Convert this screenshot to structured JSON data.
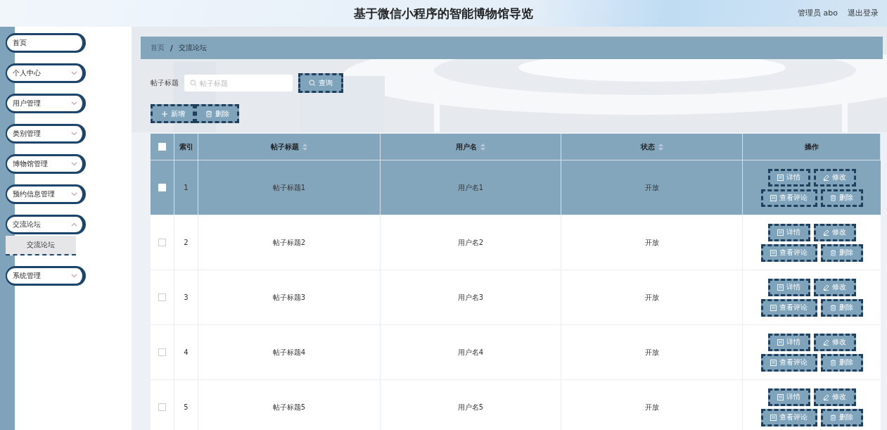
{
  "header": {
    "title": "基于微信小程序的智能博物馆导览",
    "user": "管理员 abo",
    "logout": "退出登录"
  },
  "sidebar": {
    "items": [
      {
        "label": "首页",
        "has_submenu": false
      },
      {
        "label": "个人中心",
        "has_submenu": true,
        "expanded": false
      },
      {
        "label": "用户管理",
        "has_submenu": true,
        "expanded": false
      },
      {
        "label": "类别管理",
        "has_submenu": true,
        "expanded": false
      },
      {
        "label": "博物馆管理",
        "has_submenu": true,
        "expanded": false
      },
      {
        "label": "预约信息管理",
        "has_submenu": true,
        "expanded": false
      },
      {
        "label": "交流论坛",
        "has_submenu": true,
        "expanded": true,
        "children": [
          {
            "label": "交流论坛",
            "selected": true
          }
        ]
      },
      {
        "label": "系统管理",
        "has_submenu": true,
        "expanded": false
      }
    ]
  },
  "breadcrumb": {
    "items": [
      "首页",
      "交流论坛"
    ],
    "separator": "/"
  },
  "search": {
    "label": "帖子标题",
    "placeholder": "帖子标题",
    "button": "查询"
  },
  "toolbar": [
    "新增",
    "删除"
  ],
  "table": {
    "all_checked": false,
    "columns": [
      {
        "label": "索引",
        "sortable": false
      },
      {
        "label": "帖子标题",
        "sortable": true
      },
      {
        "label": "用户名",
        "sortable": true
      },
      {
        "label": "状态",
        "sortable": true
      },
      {
        "label": "操作",
        "sortable": false
      }
    ],
    "rows": [
      {
        "index": "1",
        "title": "帖子标题1",
        "username": "用户名1",
        "status": "开放",
        "selected": true,
        "checked": false,
        "actions": [
          "详情",
          "修改",
          "查看评论",
          "删除"
        ]
      },
      {
        "index": "2",
        "title": "帖子标题2",
        "username": "用户名2",
        "status": "开放",
        "selected": false,
        "checked": false,
        "actions": [
          "详情",
          "修改",
          "查看评论",
          "删除"
        ]
      },
      {
        "index": "3",
        "title": "帖子标题3",
        "username": "用户名3",
        "status": "开放",
        "selected": false,
        "checked": false,
        "actions": [
          "详情",
          "修改",
          "查看评论",
          "删除"
        ]
      },
      {
        "index": "4",
        "title": "帖子标题4",
        "username": "用户名4",
        "status": "开放",
        "selected": false,
        "checked": false,
        "actions": [
          "详情",
          "修改",
          "查看评论",
          "删除"
        ]
      },
      {
        "index": "5",
        "title": "帖子标题5",
        "username": "用户名5",
        "status": "开放",
        "selected": false,
        "checked": false,
        "actions": [
          "详情",
          "修改",
          "查看评论",
          "删除"
        ]
      }
    ]
  }
}
